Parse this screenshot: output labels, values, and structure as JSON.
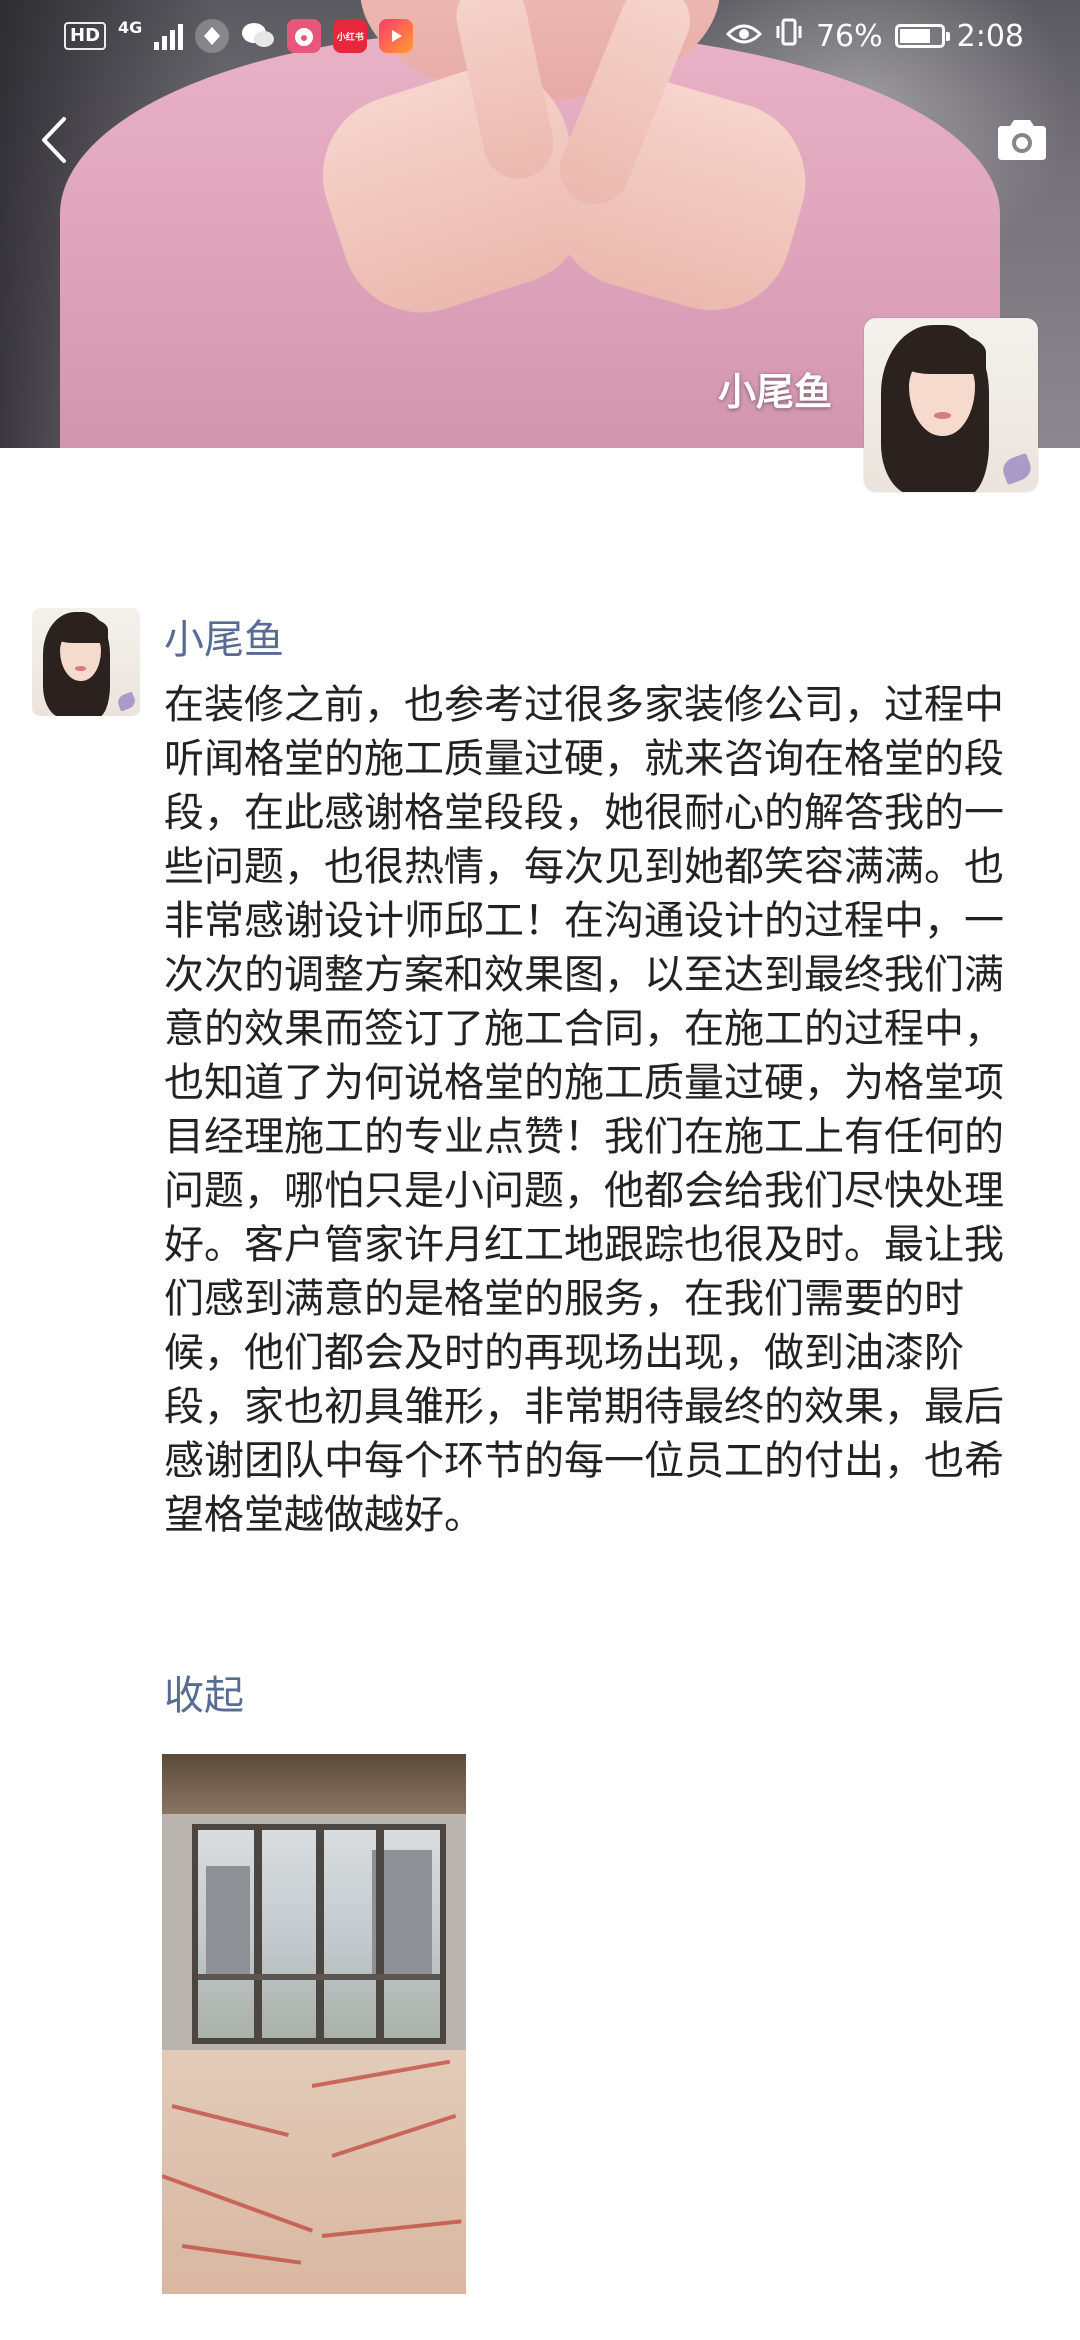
{
  "status_bar": {
    "hd_badge": "HD",
    "network": "4G",
    "app_badge_label": "小红书",
    "battery_percent_text": "76%",
    "battery_level": 0.76,
    "time": "2:08"
  },
  "header": {
    "profile_name": "小尾鱼"
  },
  "post": {
    "author": "小尾鱼",
    "text": "在装修之前，也参考过很多家装修公司，过程中听闻格堂的施工质量过硬，就来咨询在格堂的段段，在此感谢格堂段段，她很耐心的解答我的一些问题，也很热情，每次见到她都笑容满满。也非常感谢设计师邱工！在沟通设计的过程中，一次次的调整方案和效果图，以至达到最终我们满意的效果而签订了施工合同，在施工的过程中，也知道了为何说格堂的施工质量过硬，为格堂项目经理施工的专业点赞！我们在施工上有任何的问题，哪怕只是小问题，他都会给我们尽快处理好。客户管家许月红工地跟踪也很及时。最让我们感到满意的是格堂的服务，在我们需要的时候，他们都会及时的再现场出现，做到油漆阶段，家也初具雏形，非常期待最终的效果，最后感谢团队中每个环节的每一位员工的付出，也希望格堂越做越好。",
    "collapse_label": "收起"
  },
  "icons": {
    "back": "chevron-left-icon",
    "camera": "camera-icon",
    "eye": "eye-comfort-icon",
    "vibrate": "vibrate-icon"
  },
  "colors": {
    "link": "#576b95",
    "text": "#222222",
    "background": "#ffffff"
  }
}
